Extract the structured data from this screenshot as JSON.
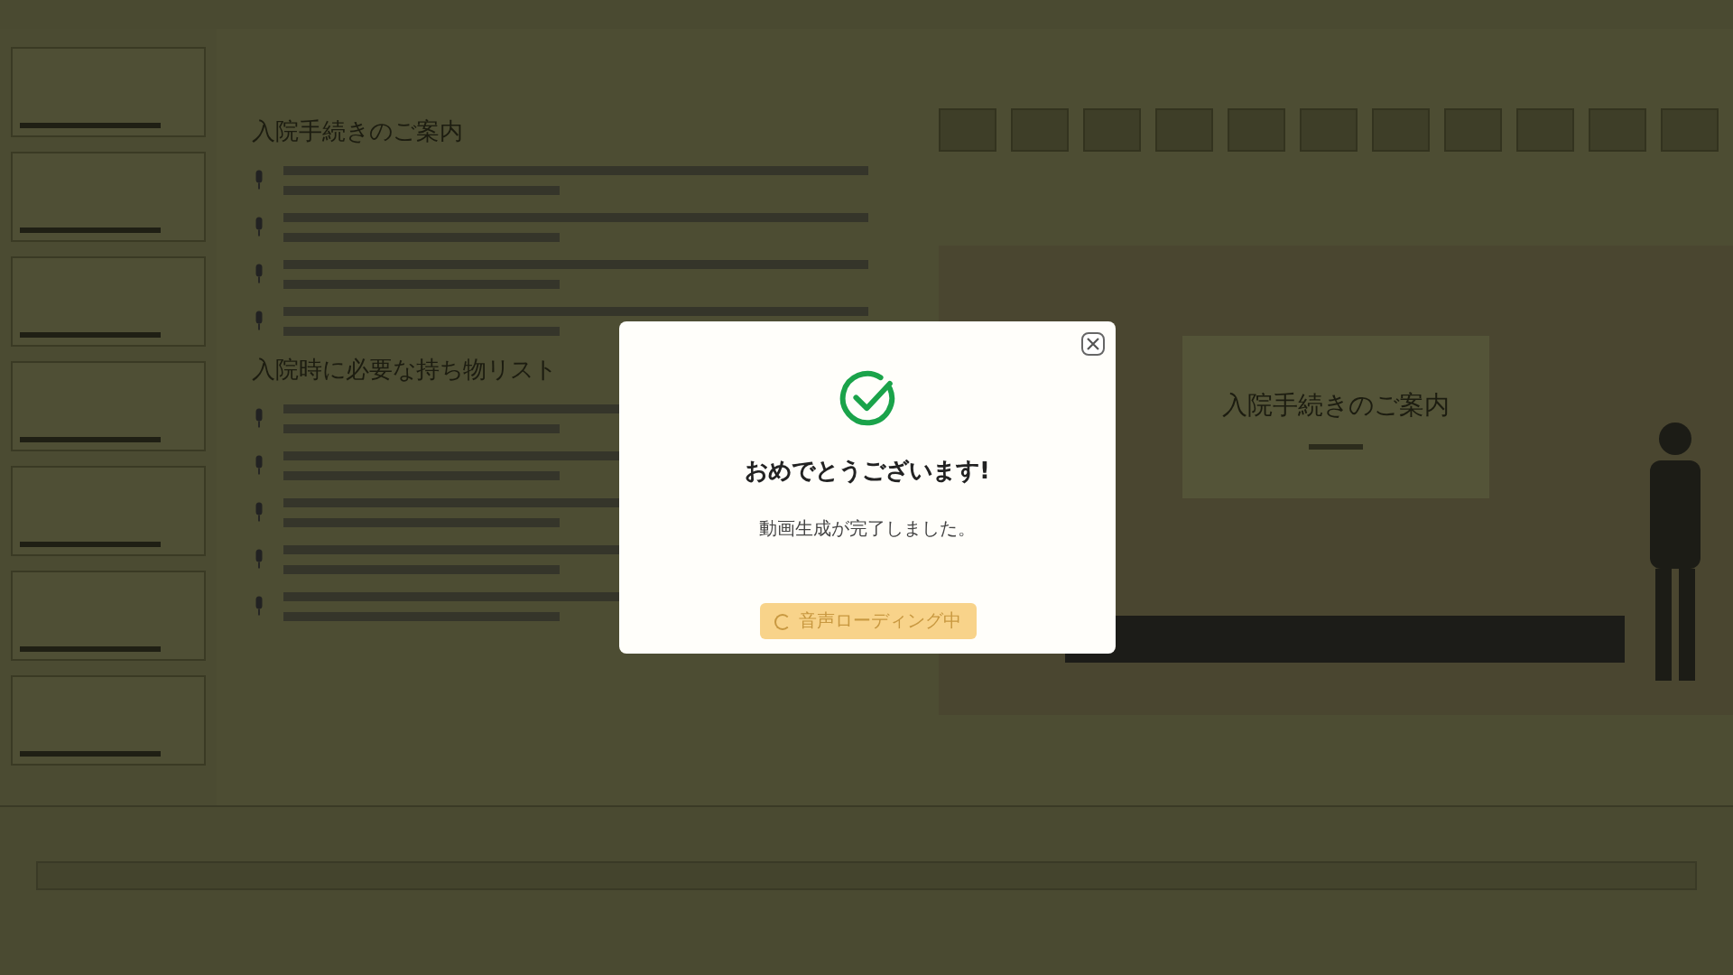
{
  "editor": {
    "sections": [
      {
        "heading": "入院手続きのご案内"
      },
      {
        "heading": "入院時に必要な持ち物リスト"
      }
    ]
  },
  "preview": {
    "slide_title": "入院手続きのご案内"
  },
  "modal": {
    "title": "おめでとうございます!",
    "message": "動画生成が完了しました。",
    "button": {
      "label": "音声ローディング中",
      "loading": true
    }
  }
}
